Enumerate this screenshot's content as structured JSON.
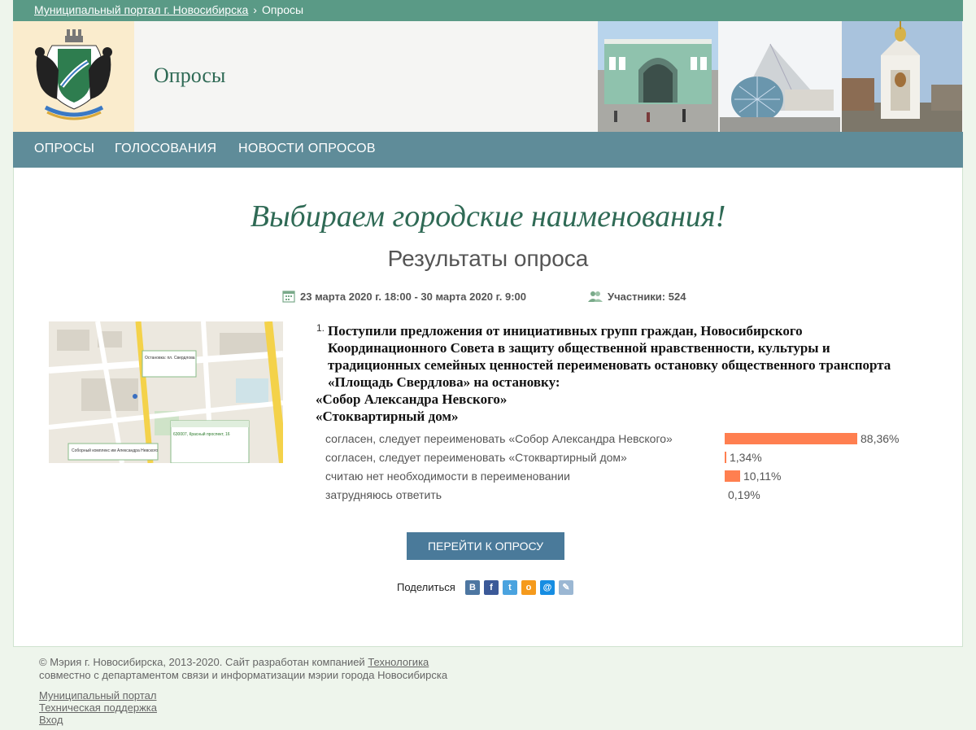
{
  "breadcrumb": {
    "home": "Муниципальный портал г. Новосибирска",
    "separator": "›",
    "current": "Опросы"
  },
  "header": {
    "title": "Опросы"
  },
  "nav": [
    {
      "label": "ОПРОСЫ"
    },
    {
      "label": "ГОЛОСОВАНИЯ"
    },
    {
      "label": "НОВОСТИ ОПРОСОВ"
    }
  ],
  "page": {
    "title": "Выбираем городские наименования!",
    "subtitle": "Результаты опроса",
    "dates": "23 марта 2020 г. 18:00 - 30 марта 2020 г. 9:00",
    "participants": "Участники: 524"
  },
  "map": {
    "label_top": "Остановка: пл. Свердлова",
    "label_bottom": "Соборный комплекс им Александра Невского",
    "label_right": "630007, Красный проспект, 16"
  },
  "question": {
    "number": "1.",
    "text": "Поступили предложения от инициативных групп граждан, Новосибирского Координационного Совета в защиту общественной нравственности, культуры и традиционных семейных ценностей переименовать остановку общественного транспорта «Площадь Свердлова» на остановку:",
    "option_a": "«Собор Александра Невского»",
    "option_b": "«Стоквартирный дом»",
    "answers": [
      {
        "label": "согласен, следует переименовать «Собор Александра Невского»",
        "percent": 88.36,
        "value": "88,36%"
      },
      {
        "label": "согласен, следует переименовать «Стоквартирный дом»",
        "percent": 1.34,
        "value": "1,34%"
      },
      {
        "label": "считаю нет необходимости в переименовании",
        "percent": 10.11,
        "value": "10,11%"
      },
      {
        "label": "затрудняюсь ответить",
        "percent": 0.19,
        "value": "0,19%"
      }
    ]
  },
  "buttons": {
    "go": "ПЕРЕЙТИ К ОПРОСУ"
  },
  "share": {
    "label": "Поделиться",
    "icons": [
      {
        "name": "vk-icon",
        "glyph": "В",
        "color": "#4d76a1"
      },
      {
        "name": "facebook-icon",
        "glyph": "f",
        "color": "#3b5998"
      },
      {
        "name": "twitter-icon",
        "glyph": "t",
        "color": "#4aa3df"
      },
      {
        "name": "odnoklassniki-icon",
        "glyph": "о",
        "color": "#f59a1c"
      },
      {
        "name": "mailru-icon",
        "glyph": "@",
        "color": "#168de2"
      },
      {
        "name": "livejournal-icon",
        "glyph": "✎",
        "color": "#9bb7d3"
      }
    ]
  },
  "footer": {
    "copyright_prefix": "© Мэрия г. Новосибирска, 2013-2020. Сайт разработан компанией",
    "company": "Технологика",
    "line2": "совместно с департаментом связи и информатизации мэрии города Новосибирска",
    "links": [
      "Муниципальный портал",
      "Техническая поддержка",
      "Вход"
    ]
  }
}
